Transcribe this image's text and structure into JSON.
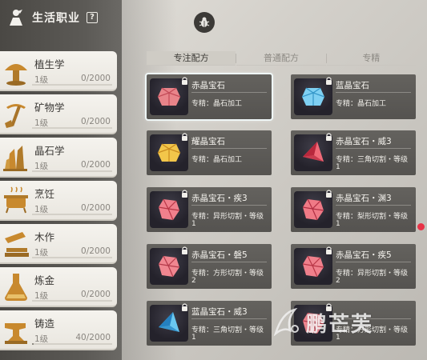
{
  "header": {
    "title": "生活职业",
    "help_label": "?"
  },
  "professions": [
    {
      "icon": "mushroom-icon",
      "name": "植生学",
      "level": "1级",
      "progress": "0/2000",
      "fill": 0
    },
    {
      "icon": "pickaxe-icon",
      "name": "矿物学",
      "level": "1级",
      "progress": "0/2000",
      "fill": 0
    },
    {
      "icon": "crystal-icon",
      "name": "晶石学",
      "level": "1级",
      "progress": "0/2000",
      "fill": 0
    },
    {
      "icon": "cooking-pot-icon",
      "name": "烹饪",
      "level": "1级",
      "progress": "0/2000",
      "fill": 0
    },
    {
      "icon": "saw-icon",
      "name": "木作",
      "level": "1级",
      "progress": "0/2000",
      "fill": 0
    },
    {
      "icon": "flask-icon",
      "name": "炼金",
      "level": "1级",
      "progress": "0/2000",
      "fill": 0
    },
    {
      "icon": "anvil-icon",
      "name": "铸造",
      "level": "1级",
      "progress": "40/2000",
      "fill": 0.02
    }
  ],
  "tabs": [
    {
      "label": "专注配方",
      "active": true
    },
    {
      "label": "普通配方",
      "active": false
    },
    {
      "label": "专精",
      "active": false
    }
  ],
  "recipes": [
    {
      "name": "赤晶宝石",
      "req": "专精：晶石加工",
      "req2": "",
      "gem": "red",
      "selected": true
    },
    {
      "name": "蓝晶宝石",
      "req": "专精：晶石加工",
      "req2": "",
      "gem": "blue",
      "selected": false
    },
    {
      "name": "耀晶宝石",
      "req": "专精：晶石加工",
      "req2": "",
      "gem": "yellow",
      "selected": false
    },
    {
      "name": "赤晶宝石・威3",
      "req": "专精：三角切割・等级",
      "req2": "1",
      "gem": "red-tri",
      "selected": false
    },
    {
      "name": "赤晶宝石・疾3",
      "req": "专精：异形切割・等级",
      "req2": "1",
      "gem": "red-irr",
      "selected": false
    },
    {
      "name": "赤晶宝石・渊3",
      "req": "专精：梨形切割・等级",
      "req2": "1",
      "gem": "red-pear",
      "selected": false
    },
    {
      "name": "赤晶宝石・磐5",
      "req": "专精：方形切割・等级",
      "req2": "2",
      "gem": "red-sq",
      "selected": false
    },
    {
      "name": "赤晶宝石・疾5",
      "req": "专精：异形切割・等级",
      "req2": "2",
      "gem": "red-irr",
      "selected": false
    },
    {
      "name": "蓝晶宝石・威3",
      "req": "专精：三角切割・等级",
      "req2": "1",
      "gem": "blue-tri",
      "selected": false
    },
    {
      "name": "",
      "req": "专精：方形切割・等级",
      "req2": "1",
      "gem": "red-sq",
      "selected": false
    }
  ],
  "watermark": "鹏芒芙"
}
